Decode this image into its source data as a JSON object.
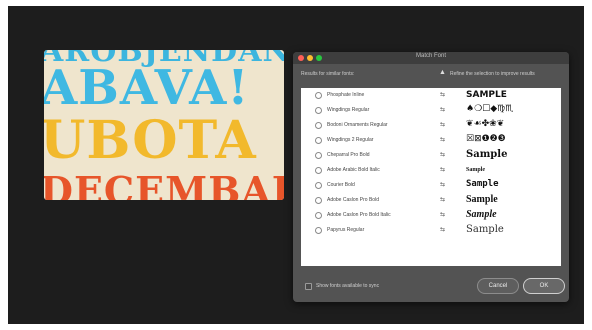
{
  "poster": {
    "lines": [
      "AROBJENDAN",
      "ABAVA!",
      "UBOTA",
      "DECEMBAR"
    ]
  },
  "dialog": {
    "title": "Match Font",
    "results_label": "Results for similar fonts:",
    "refine_text": "Refine the selection to improve results",
    "fonts": [
      {
        "name": "Phosphate Inline",
        "icon": "typekit-icon",
        "sample": "SAMPLE"
      },
      {
        "name": "Wingdings Regular",
        "icon": "typekit-icon",
        "sample": "♠❍☐◆♍♏"
      },
      {
        "name": "Bodoni Ornaments Regular",
        "icon": "typekit-icon",
        "sample": "❦☙✤❀❦"
      },
      {
        "name": "Wingdings 2 Regular",
        "icon": "typekit-icon",
        "sample": "☒⊠❶❷❸"
      },
      {
        "name": "Cheparral Pro Bold",
        "icon": "typekit-icon",
        "sample": "Sample"
      },
      {
        "name": "Adobe Arabic Bold Italic",
        "icon": "typekit-icon",
        "sample": "Sample"
      },
      {
        "name": "Courier Bold",
        "icon": "typekit-icon",
        "sample": "Sample"
      },
      {
        "name": "Adobe Caslon Pro Bold",
        "icon": "typekit-icon",
        "sample": "Sample"
      },
      {
        "name": "Adobe Caslon Pro Bold Italic",
        "icon": "typekit-icon",
        "sample": "Sample"
      },
      {
        "name": "Papyrus Regular",
        "icon": "typekit-icon",
        "sample": "Sample"
      }
    ],
    "show_fonts_label": "Show fonts available to sync",
    "cancel_label": "Cancel",
    "ok_label": "OK"
  }
}
